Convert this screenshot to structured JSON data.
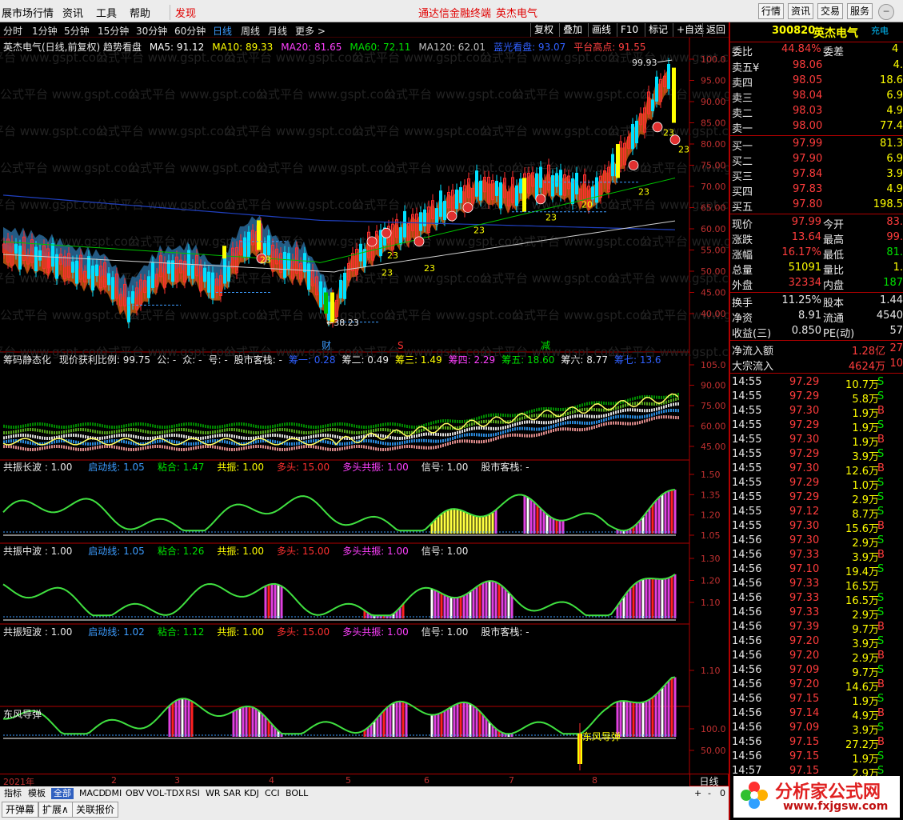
{
  "menu": {
    "items": [
      "展市场行情",
      "资讯",
      "工具",
      "帮助",
      "发现"
    ],
    "app_title": "通达信金融终端",
    "stock_title": "英杰电气",
    "right_buttons": [
      "行情",
      "资讯",
      "交易",
      "服务"
    ]
  },
  "periods": [
    "分时",
    "1分钟",
    "5分钟",
    "15分钟",
    "30分钟",
    "60分钟",
    "日线",
    "周线",
    "月线",
    "更多 >"
  ],
  "active_period": "日线",
  "toolbar": [
    "复权",
    "叠加",
    "画线",
    "F10",
    "标记",
    "+自选",
    "返回"
  ],
  "main_chart": {
    "title": "英杰电气(日线,前复权) 趋势看盘",
    "ma": [
      {
        "label": "MA5: 91.12",
        "color": "#ffffff"
      },
      {
        "label": "MA10: 89.33",
        "color": "#ffff00"
      },
      {
        "label": "MA20: 81.65",
        "color": "#ff40ff"
      },
      {
        "label": "MA60: 72.11",
        "color": "#00e000"
      },
      {
        "label": "MA120: 62.01",
        "color": "#c0c0c0"
      },
      {
        "label": "蓝光看盘: 93.07",
        "color": "#3060ff"
      },
      {
        "label": "平台高点: 91.55",
        "color": "#ff4040"
      }
    ],
    "y_ticks": [
      "100.0",
      "95.00",
      "90.00",
      "85.00",
      "80.00",
      "75.00",
      "70.00",
      "65.00",
      "60.00",
      "55.00",
      "50.00",
      "45.00",
      "40.00"
    ],
    "high_label": "99.93",
    "low_label": "38.23",
    "markers": [
      "财",
      "S",
      "减"
    ],
    "signal_label": "23",
    "signal_label_20": "20"
  },
  "chip_panel": {
    "title": "筹码静态化",
    "items": [
      {
        "label": "现价获利比例: 99.75",
        "color": "#e8e8e8"
      },
      {
        "label": "公: -",
        "color": "#e8e8e8"
      },
      {
        "label": "众: -",
        "color": "#e8e8e8"
      },
      {
        "label": "号: -",
        "color": "#e8e8e8"
      },
      {
        "label": "股市客栈: -",
        "color": "#e8e8e8"
      },
      {
        "label": "筹一: 0.28",
        "color": "#3060ff"
      },
      {
        "label": "筹二: 0.49",
        "color": "#e8e8e8"
      },
      {
        "label": "筹三: 1.49",
        "color": "#ffff00"
      },
      {
        "label": "筹四: 2.29",
        "color": "#ff40ff"
      },
      {
        "label": "筹五: 18.60",
        "color": "#00e000"
      },
      {
        "label": "筹六: 8.77",
        "color": "#e8e8e8"
      },
      {
        "label": "筹七: 13.6",
        "color": "#3060ff"
      }
    ],
    "y_ticks": [
      "105.0",
      "90.00",
      "75.00",
      "60.00",
      "45.00"
    ]
  },
  "wave_panels": [
    {
      "title": "共振长波 : 1.00",
      "items": [
        "启动线: 1.05",
        "粘合: 1.47",
        "共振: 1.00",
        "多头: 15.00",
        "多头共振: 1.00",
        "信号: 1.00",
        "股市客栈: -"
      ],
      "y_ticks": [
        "1.50",
        "1.35",
        "1.20",
        "1.05"
      ]
    },
    {
      "title": "共振中波 : 1.00",
      "items": [
        "启动线: 1.05",
        "粘合: 1.26",
        "共振: 1.00",
        "多头: 15.00",
        "多头共振: 1.00",
        "信号: 1.00"
      ],
      "y_ticks": [
        "1.30",
        "1.20",
        "1.10"
      ]
    },
    {
      "title": "共振短波 : 1.00",
      "items": [
        "启动线: 1.02",
        "粘合: 1.12",
        "共振: 1.00",
        "多头: 15.00",
        "多头共振: 1.00",
        "信号: 1.00",
        "股市客栈: -"
      ],
      "y_ticks": [
        "1.10"
      ]
    }
  ],
  "dongfeng": {
    "title": "东风导弹",
    "label": "东风导弹",
    "y_ticks": [
      "100.0",
      "50.00"
    ]
  },
  "dates": [
    "2021年",
    "2",
    "3",
    "4",
    "5",
    "6",
    "7",
    "8"
  ],
  "period_label": "日线",
  "bottom_tabs": [
    "指标",
    "模板",
    "全部",
    "MACD",
    "DMI",
    "OBV",
    "VOL-TDX",
    "RSI",
    "WR",
    "SAR",
    "KDJ",
    "CCI",
    "BOLL"
  ],
  "bottom_buttons": [
    "开弹幕",
    "扩展∧",
    "关联报价"
  ],
  "zoom_controls": [
    "+",
    "-",
    "0"
  ],
  "quote": {
    "code": "300820",
    "name": "英杰电气",
    "tag": "充电",
    "webi_label": "委比",
    "webi": "44.84%",
    "weicha_label": "委差",
    "weicha": "4",
    "asks": [
      {
        "label": "卖五",
        "price": "98.06",
        "vol": "4.",
        "flag": "¥"
      },
      {
        "label": "卖四",
        "price": "98.05",
        "vol": "18.6"
      },
      {
        "label": "卖三",
        "price": "98.04",
        "vol": "6.9"
      },
      {
        "label": "卖二",
        "price": "98.03",
        "vol": "4.9"
      },
      {
        "label": "卖一",
        "price": "98.00",
        "vol": "77.4"
      }
    ],
    "bids": [
      {
        "label": "买一",
        "price": "97.99",
        "vol": "81.3"
      },
      {
        "label": "买二",
        "price": "97.90",
        "vol": "6.9"
      },
      {
        "label": "买三",
        "price": "97.84",
        "vol": "3.9"
      },
      {
        "label": "买四",
        "price": "97.83",
        "vol": "4.9"
      },
      {
        "label": "买五",
        "price": "97.80",
        "vol": "198.5"
      }
    ],
    "stats": [
      {
        "l1": "现价",
        "v1": "97.99",
        "l2": "今开",
        "v2": "83."
      },
      {
        "l1": "涨跌",
        "v1": "13.64",
        "l2": "最高",
        "v2": "99."
      },
      {
        "l1": "涨幅",
        "v1": "16.17%",
        "l2": "最低",
        "v2": "81."
      },
      {
        "l1": "总量",
        "v1": "51091",
        "l2": "量比",
        "v2": "1."
      },
      {
        "l1": "外盘",
        "v1": "32334",
        "l2": "内盘",
        "v2": "187"
      }
    ],
    "stats2": [
      {
        "l1": "换手",
        "v1": "11.25%",
        "l2": "股本",
        "v2": "1.44"
      },
      {
        "l1": "净资",
        "v1": "8.91",
        "l2": "流通",
        "v2": "4540"
      },
      {
        "l1": "收益(三)",
        "v1": "0.850",
        "l2": "PE(动)",
        "v2": "57"
      }
    ],
    "flow": [
      {
        "label": "净流入额",
        "value": "1.28亿",
        "extra": "27"
      },
      {
        "label": "大宗流入",
        "value": "4624万",
        "extra": "10"
      }
    ],
    "ticks": [
      {
        "t": "14:55",
        "p": "97.29",
        "v": "10.7万",
        "s": "S"
      },
      {
        "t": "14:55",
        "p": "97.29",
        "v": "5.8万",
        "s": "S"
      },
      {
        "t": "14:55",
        "p": "97.30",
        "v": "1.9万",
        "s": "B"
      },
      {
        "t": "14:55",
        "p": "97.29",
        "v": "1.9万",
        "s": "S"
      },
      {
        "t": "14:55",
        "p": "97.30",
        "v": "1.9万",
        "s": "B"
      },
      {
        "t": "14:55",
        "p": "97.29",
        "v": "3.9万",
        "s": "S"
      },
      {
        "t": "14:55",
        "p": "97.30",
        "v": "12.6万",
        "s": "B"
      },
      {
        "t": "14:55",
        "p": "97.29",
        "v": "1.0万",
        "s": "S"
      },
      {
        "t": "14:55",
        "p": "97.29",
        "v": "2.9万",
        "s": "S"
      },
      {
        "t": "14:55",
        "p": "97.12",
        "v": "8.7万",
        "s": "S"
      },
      {
        "t": "14:55",
        "p": "97.30",
        "v": "15.6万",
        "s": "B"
      },
      {
        "t": "14:56",
        "p": "97.30",
        "v": "2.9万",
        "s": "S"
      },
      {
        "t": "14:56",
        "p": "97.33",
        "v": "3.9万",
        "s": "B"
      },
      {
        "t": "14:56",
        "p": "97.10",
        "v": "19.4万",
        "s": "S"
      },
      {
        "t": "14:56",
        "p": "97.33",
        "v": "16.5万",
        "s": ""
      },
      {
        "t": "14:56",
        "p": "97.33",
        "v": "16.5万",
        "s": "S"
      },
      {
        "t": "14:56",
        "p": "97.33",
        "v": "2.9万",
        "s": "S"
      },
      {
        "t": "14:56",
        "p": "97.39",
        "v": "9.7万",
        "s": "B"
      },
      {
        "t": "14:56",
        "p": "97.20",
        "v": "3.9万",
        "s": "S"
      },
      {
        "t": "14:56",
        "p": "97.20",
        "v": "2.9万",
        "s": "B"
      },
      {
        "t": "14:56",
        "p": "97.09",
        "v": "9.7万",
        "s": "S"
      },
      {
        "t": "14:56",
        "p": "97.20",
        "v": "14.6万",
        "s": "B"
      },
      {
        "t": "14:56",
        "p": "97.15",
        "v": "1.9万",
        "s": "S"
      },
      {
        "t": "14:56",
        "p": "97.14",
        "v": "4.9万",
        "s": "B"
      },
      {
        "t": "14:56",
        "p": "97.09",
        "v": "3.9万",
        "s": "S"
      },
      {
        "t": "14:56",
        "p": "97.15",
        "v": "27.2万",
        "s": "B"
      },
      {
        "t": "14:56",
        "p": "97.15",
        "v": "1.9万",
        "s": "S"
      },
      {
        "t": "14:57",
        "p": "97.15",
        "v": "2.9万",
        "s": "S"
      }
    ]
  },
  "watermark": "公式平台 www.gspt.com",
  "logo": {
    "title": "分析家公式网",
    "url": "www.fxjgsw.com"
  }
}
